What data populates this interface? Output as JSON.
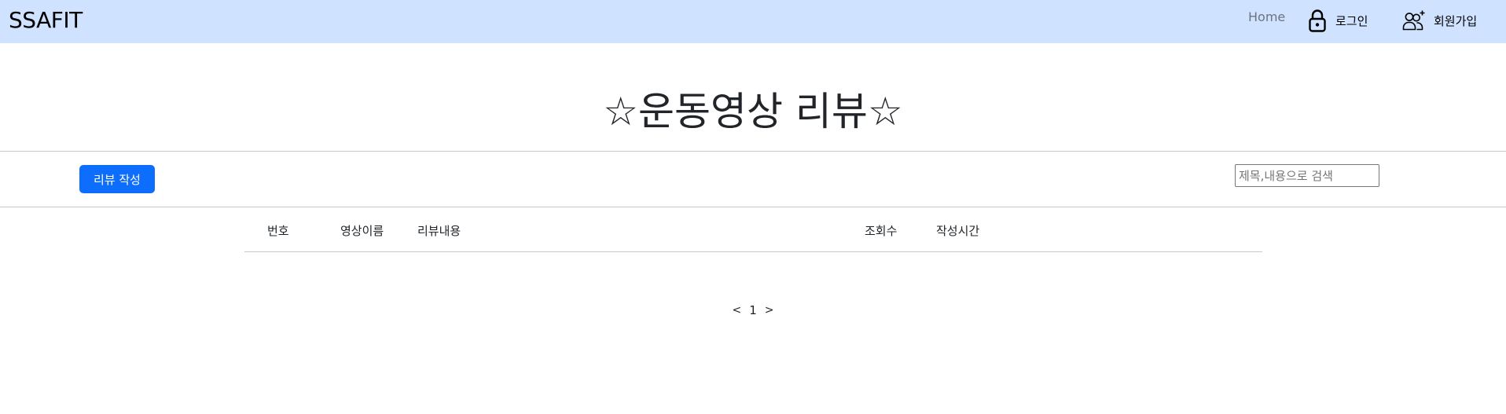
{
  "navbar": {
    "brand": "SSAFIT",
    "home": "Home",
    "login": "로그인",
    "signup": "회원가입",
    "login_icon": "lock-icon",
    "signup_icon": "person-plus-icon",
    "background": "#cfe2ff"
  },
  "page": {
    "title": "☆운동영상 리뷰☆"
  },
  "toolbar": {
    "write_button": "리뷰 작성",
    "search_placeholder": "제목,내용으로 검색",
    "search_value": "",
    "accent": "#0d6efd"
  },
  "table": {
    "headers": [
      "번호",
      "영상이름",
      "리뷰내용",
      "조회수",
      "작성시간"
    ],
    "rows": []
  },
  "pagination": {
    "prev": "<",
    "current": "1",
    "next": ">"
  }
}
